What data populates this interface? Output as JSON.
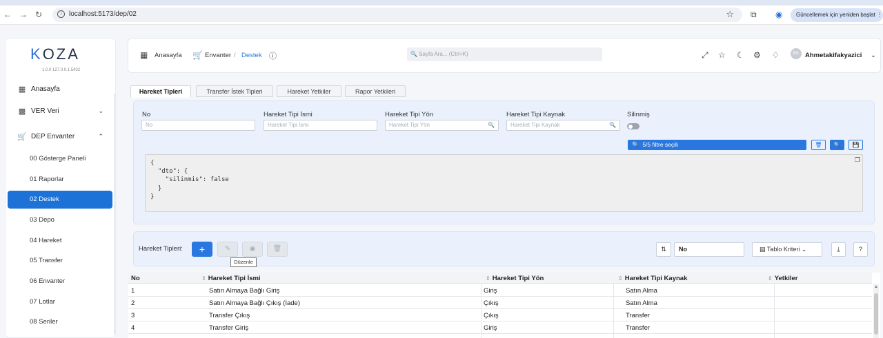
{
  "browser": {
    "url": "localhost:5173/dep/02",
    "update_label": "Güncellemek için yeniden başlat"
  },
  "sidebar": {
    "logo": "KOZA",
    "version": "1.0.0  127.0.0.1.5432",
    "items": [
      {
        "label": "Anasayfa",
        "icon": "grid-icon"
      },
      {
        "label": "VER Veri",
        "icon": "bar-chart-icon"
      },
      {
        "label": "DEP Envanter",
        "icon": "cart-icon"
      }
    ],
    "sub_items": [
      "00 Gösterge Paneli",
      "01 Raporlar",
      "02 Destek",
      "03 Depo",
      "04 Hareket",
      "05 Transfer",
      "06 Envanter",
      "07 Lotlar",
      "08 Seriler"
    ],
    "active_sub": "02 Destek"
  },
  "header": {
    "home": "Anasayfa",
    "section": "Envanter",
    "separator": "/",
    "current": "Destek",
    "search_placeholder": "Sayfa Ara... (Ctrl+K)",
    "user": "Ahmetakifakyazici",
    "avatar_initials": "BK"
  },
  "tabs": [
    "Hareket Tipleri",
    "Transfer İstek Tipleri",
    "Hareket Yetkiler",
    "Rapor Yetkileri"
  ],
  "filters": {
    "fields": [
      {
        "label": "No",
        "placeholder": "No"
      },
      {
        "label": "Hareket Tipi İsmi",
        "placeholder": "Hareket Tipi İsmi"
      },
      {
        "label": "Hareket Tipi Yön",
        "placeholder": "Hareket Tipi Yön"
      },
      {
        "label": "Hareket Tipi Kaynak",
        "placeholder": "Hareket Tipi Kaynak"
      }
    ],
    "toggle_label": "Silinmiş",
    "summary": "5/5 filtre seçili",
    "json": "{\n  \"dto\": {\n    \"silinmis\": false\n  }\n}"
  },
  "toolbar": {
    "label": "Hareket Tipleri:",
    "add_symbol": "+",
    "tooltip": "Düzenle",
    "sort_field": "No",
    "columns_label": "Tablo Kriteri",
    "help": "?"
  },
  "table": {
    "headers": [
      "No",
      "Hareket Tipi İsmi",
      "Hareket Tipi Yön",
      "Hareket Tipi Kaynak",
      "Yetkiler"
    ],
    "rows": [
      [
        "1",
        "Satın Almaya Bağlı Giriş",
        "Giriş",
        "Satın Alma",
        ""
      ],
      [
        "2",
        "Satın Almaya Bağlı Çıkış (İade)",
        "Çıkış",
        "Satın Alma",
        ""
      ],
      [
        "3",
        "Transfer Çıkış",
        "Çıkış",
        "Transfer",
        ""
      ],
      [
        "4",
        "Transfer Giriş",
        "Giriş",
        "Transfer",
        ""
      ]
    ]
  },
  "colors": {
    "accent": "#2a77e0",
    "active_nav": "#1d72d8",
    "panel": "#eaf1fc"
  }
}
